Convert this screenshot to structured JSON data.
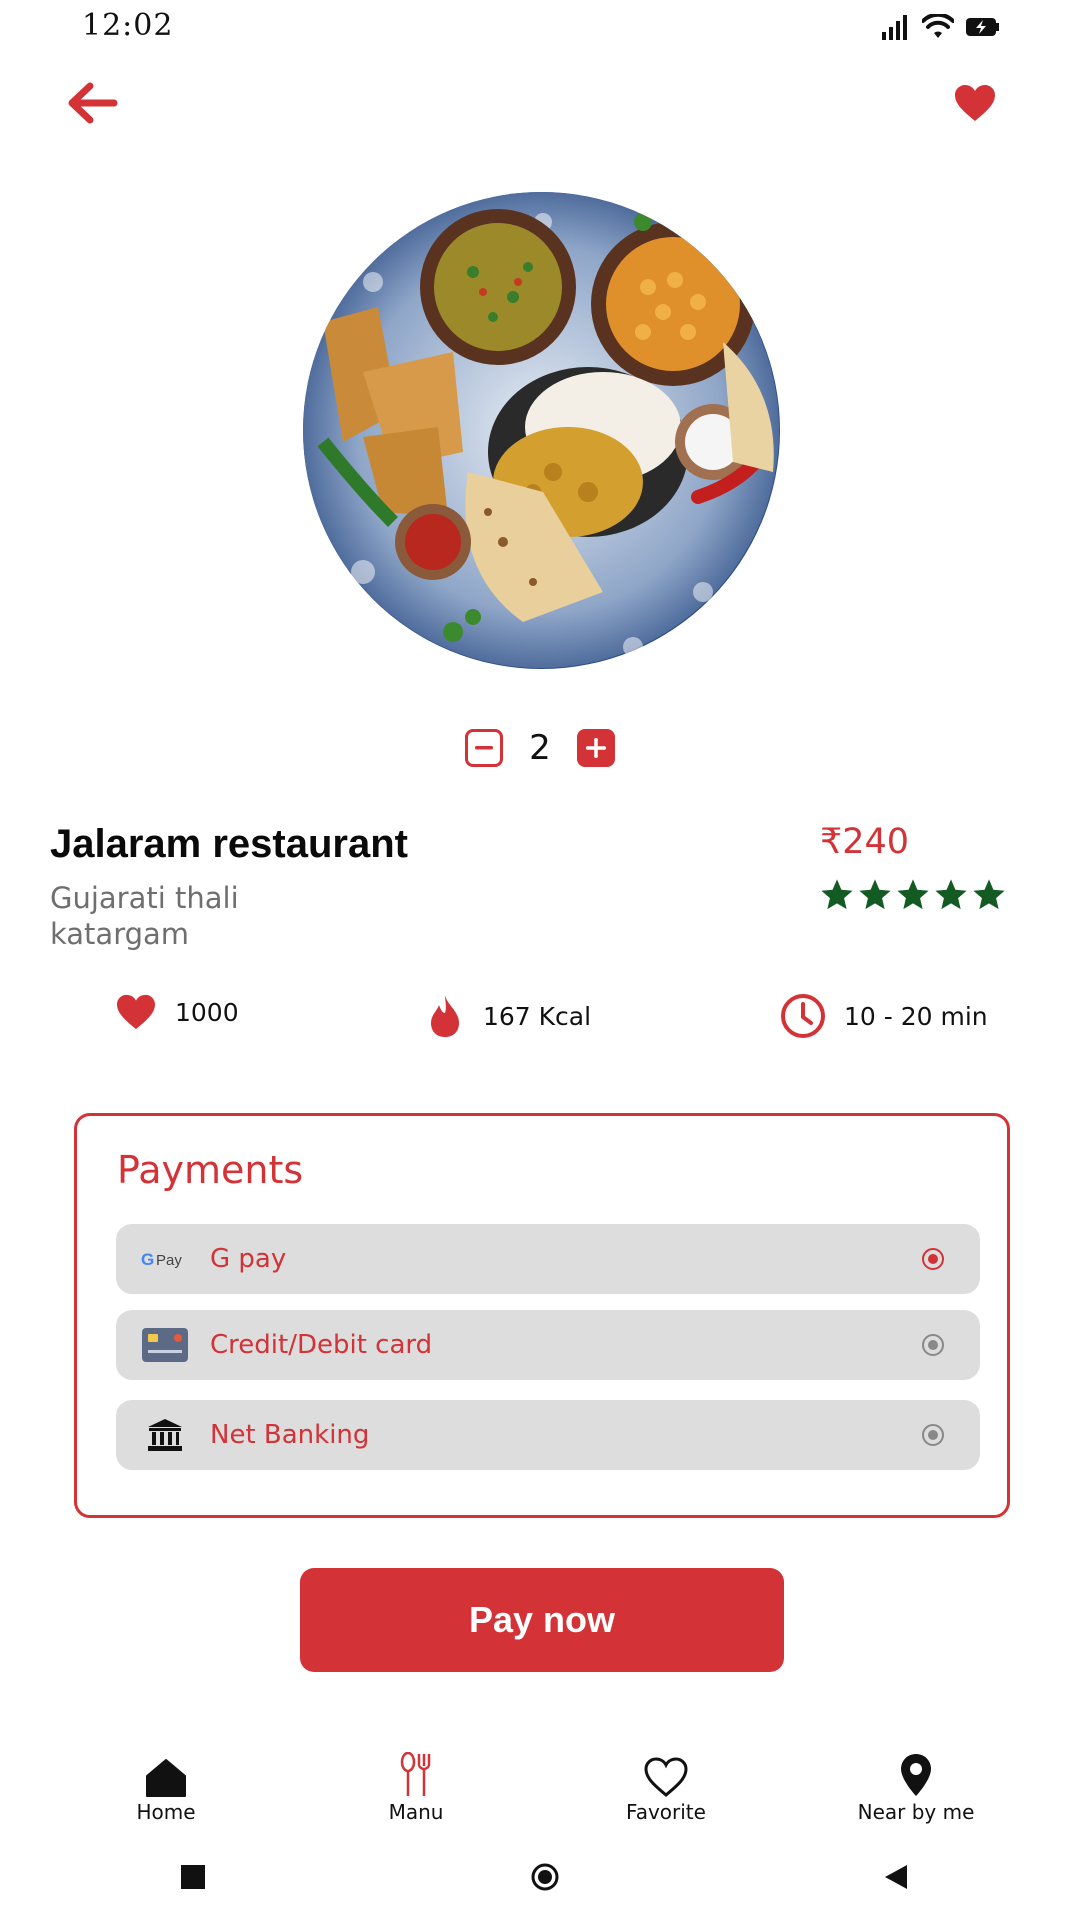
{
  "status_bar": {
    "time": "12:02",
    "icons": [
      "signal-icon",
      "wifi-icon",
      "battery-charging-icon"
    ]
  },
  "header": {
    "back_icon": "arrow-left-icon",
    "favorite_icon": "heart-filled-icon"
  },
  "food": {
    "image_description": "thali",
    "quantity": "2"
  },
  "restaurant": {
    "name": "Jalaram restaurant",
    "dish": "Gujarati thali",
    "location": "katargam",
    "price": "₹240",
    "rating": 5
  },
  "stats": {
    "likes": "1000",
    "calories": "167 Kcal",
    "time": "10 - 20 min"
  },
  "payments": {
    "title": "Payments",
    "options": [
      {
        "label": "G pay",
        "icon": "gpay-icon",
        "icon_text": "Pay",
        "selected": true
      },
      {
        "label": "Credit/Debit card",
        "icon": "credit-card-icon",
        "selected": false
      },
      {
        "label": "Net Banking",
        "icon": "bank-icon",
        "selected": false
      }
    ]
  },
  "pay_now_label": "Pay now",
  "bottom_nav": [
    {
      "label": "Home",
      "icon": "home-icon"
    },
    {
      "label": "Manu",
      "icon": "fork-spoon-icon"
    },
    {
      "label": "Favorite",
      "icon": "heart-outline-icon"
    },
    {
      "label": "Near by me",
      "icon": "location-pin-icon"
    }
  ],
  "colors": {
    "accent": "#d33236",
    "star": "#145a23",
    "row_bg": "#dddddd"
  }
}
